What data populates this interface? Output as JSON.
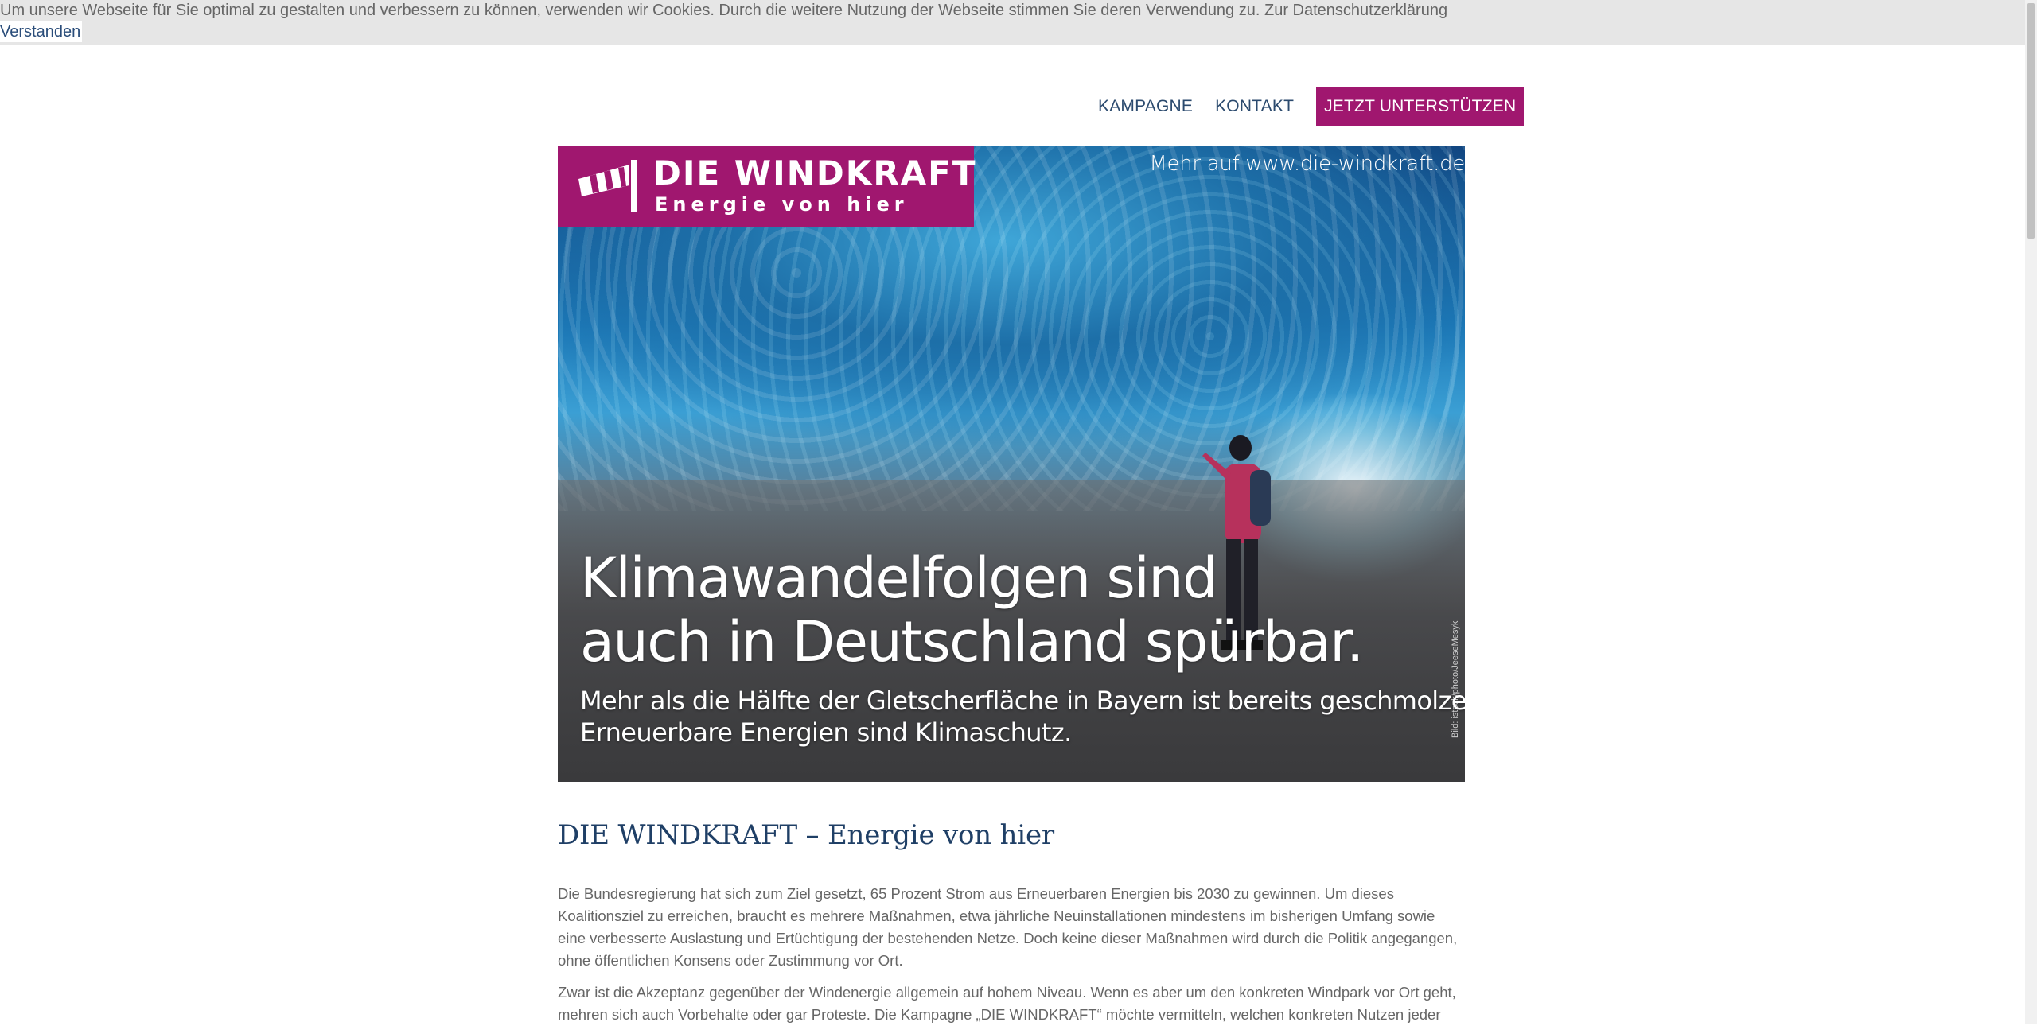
{
  "cookie": {
    "text": "Um unsere Webseite für Sie optimal zu gestalten und verbessern zu können, verwenden wir Cookies. Durch die weitere Nutzung der Webseite stimmen Sie deren Verwendung zu. Zur Datenschutzerklärung",
    "button": "Verstanden"
  },
  "nav": {
    "items": [
      {
        "label": "KAMPAGNE"
      },
      {
        "label": "KONTAKT"
      }
    ],
    "cta": "JETZT UNTERSTÜTZEN"
  },
  "hero": {
    "logo_title": "DIE WINDKRAFT",
    "logo_subtitle": "Energie von hier",
    "url": "Mehr auf www.die-windkraft.de",
    "headline_line1": "Klimawandelfolgen sind",
    "headline_line2": "auch in Deutschland spürbar.",
    "sub_line1": "Mehr als die Hälfte der Gletscherfläche in Bayern ist bereits geschmolzen.",
    "sub_line2": "Erneuerbare Energien sind Klimaschutz.",
    "credit": "Bild: istock/photo/JeeseMesyk"
  },
  "article": {
    "title": "DIE WINDKRAFT – Energie von hier",
    "paragraph1": "Die Bundesregierung hat sich zum Ziel gesetzt, 65 Prozent Strom aus Erneuerbaren Energien bis 2030 zu gewinnen. Um dieses Koalitionsziel zu erreichen, braucht es mehrere Maßnahmen, etwa jährliche Neuinstallationen mindestens im bisherigen Umfang sowie eine verbesserte Auslastung und Ertüchtigung der bestehenden Netze. Doch keine dieser Maßnahmen wird durch die Politik angegangen, ohne öffentlichen Konsens oder Zustimmung vor Ort.",
    "paragraph2": "Zwar ist die Akzeptanz gegenüber der Windenergie allgemein auf hohem Niveau. Wenn es aber um den konkreten Windpark vor Ort geht, mehren sich auch Vorbehalte oder gar Proteste. Die Kampagne „DIE WINDKRAFT“ möchte vermitteln, welchen konkreten Nutzen jeder"
  },
  "colors": {
    "brand": "#a0176f",
    "heading": "#1f3f66",
    "nav_text": "#2b4a6e"
  }
}
